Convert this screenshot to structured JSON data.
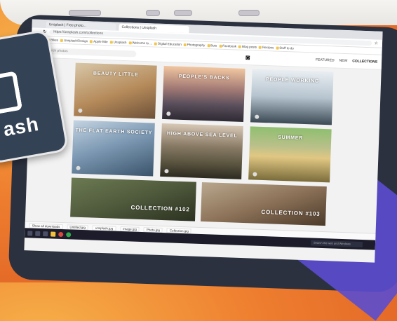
{
  "browser": {
    "tabs": [
      {
        "label": "Unsplash | Free photo..."
      },
      {
        "label": "Collections | Unsplash"
      }
    ],
    "address": "https://unsplash.com/collections",
    "bookmarks": [
      "Apps",
      "Bikes",
      "Unsplash/Design",
      "Apple Bite",
      "Unsplash",
      "Welcome to ...",
      "Digital Education",
      "Photography",
      "Bots",
      "Facebook",
      "Blog posts",
      "Recipes",
      "Stuff to do"
    ]
  },
  "site": {
    "search_placeholder": "Search photos",
    "camera_icon": "camera-icon",
    "nav": [
      "FEATURED",
      "NEW",
      "COLLECTIONS"
    ]
  },
  "collections": [
    {
      "title": "BEAUTY LITTLE",
      "photos": "",
      "curator": ""
    },
    {
      "title": "PEOPLE'S BACKS",
      "photos": "",
      "curator": ""
    },
    {
      "title": "PEOPLE WORKING",
      "photos": "",
      "curator": ""
    },
    {
      "title": "THE FLAT EARTH SOCIETY",
      "photos": "",
      "curator": ""
    },
    {
      "title": "HIGH ABOVE SEA LEVEL",
      "photos": "",
      "curator": ""
    },
    {
      "title": "SUMMER",
      "photos": "",
      "curator": ""
    },
    {
      "title": "COLLECTION #102",
      "photos": "",
      "curator": ""
    },
    {
      "title": "COLLECTION #103",
      "photos": "",
      "curator": ""
    }
  ],
  "downloads": [
    "Show all downloads",
    "Untitled.jpg",
    "unsplash.jpg",
    "Image.jpg",
    "Photo.jpg",
    "Collection.jpg"
  ],
  "taskbar": {
    "search": "Search the web and Windows"
  },
  "logo": {
    "text": "ash"
  }
}
